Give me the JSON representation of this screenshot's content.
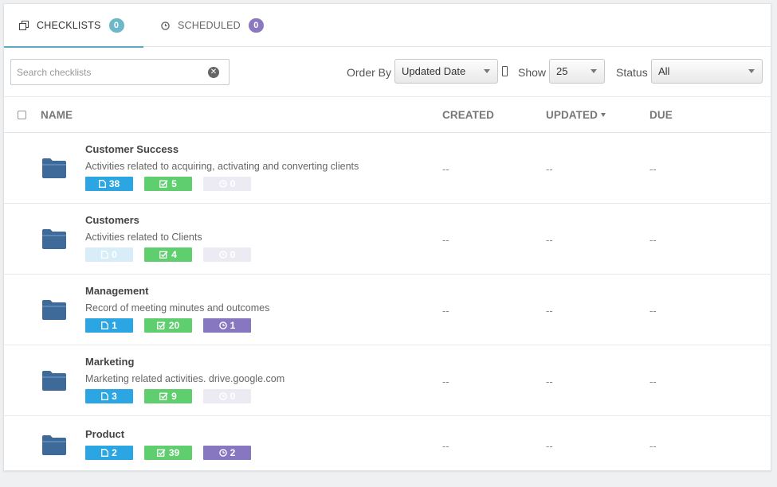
{
  "tabs": [
    {
      "label": "CHECKLISTS",
      "count": "0",
      "icon": "copy-icon"
    },
    {
      "label": "SCHEDULED",
      "count": "0",
      "icon": "clock-icon"
    }
  ],
  "filters": {
    "search_placeholder": "Search checklists",
    "order_by_label": "Order By",
    "order_by_value": "Updated Date",
    "show_label": "Show",
    "show_value": "25",
    "status_label": "Status",
    "status_value": "All"
  },
  "columns": {
    "name": "NAME",
    "created": "CREATED",
    "updated": "UPDATED",
    "due": "DUE"
  },
  "rows": [
    {
      "title": "Customer Success",
      "desc": "Activities related to acquiring, activating and converting clients",
      "docs": "38",
      "checks": "5",
      "scheduled": "0",
      "created": "--",
      "updated": "--",
      "due": "--"
    },
    {
      "title": "Customers",
      "desc": "Activities related to Clients",
      "docs": "0",
      "checks": "4",
      "scheduled": "0",
      "created": "--",
      "updated": "--",
      "due": "--"
    },
    {
      "title": "Management",
      "desc": "Record of meeting minutes and outcomes",
      "docs": "1",
      "checks": "20",
      "scheduled": "1",
      "created": "--",
      "updated": "--",
      "due": "--"
    },
    {
      "title": "Marketing",
      "desc": "Marketing related activities. drive.google.com",
      "docs": "3",
      "checks": "9",
      "scheduled": "0",
      "created": "--",
      "updated": "--",
      "due": "--"
    },
    {
      "title": "Product",
      "desc": "",
      "docs": "2",
      "checks": "39",
      "scheduled": "2",
      "created": "--",
      "updated": "--",
      "due": "--"
    }
  ],
  "colors": {
    "tab_accent": "#5aaac0",
    "doc_pill": "#2ca6e2",
    "check_pill": "#5fce6f",
    "scheduled_pill": "#8777c1",
    "folder": "#3e6a9a"
  }
}
